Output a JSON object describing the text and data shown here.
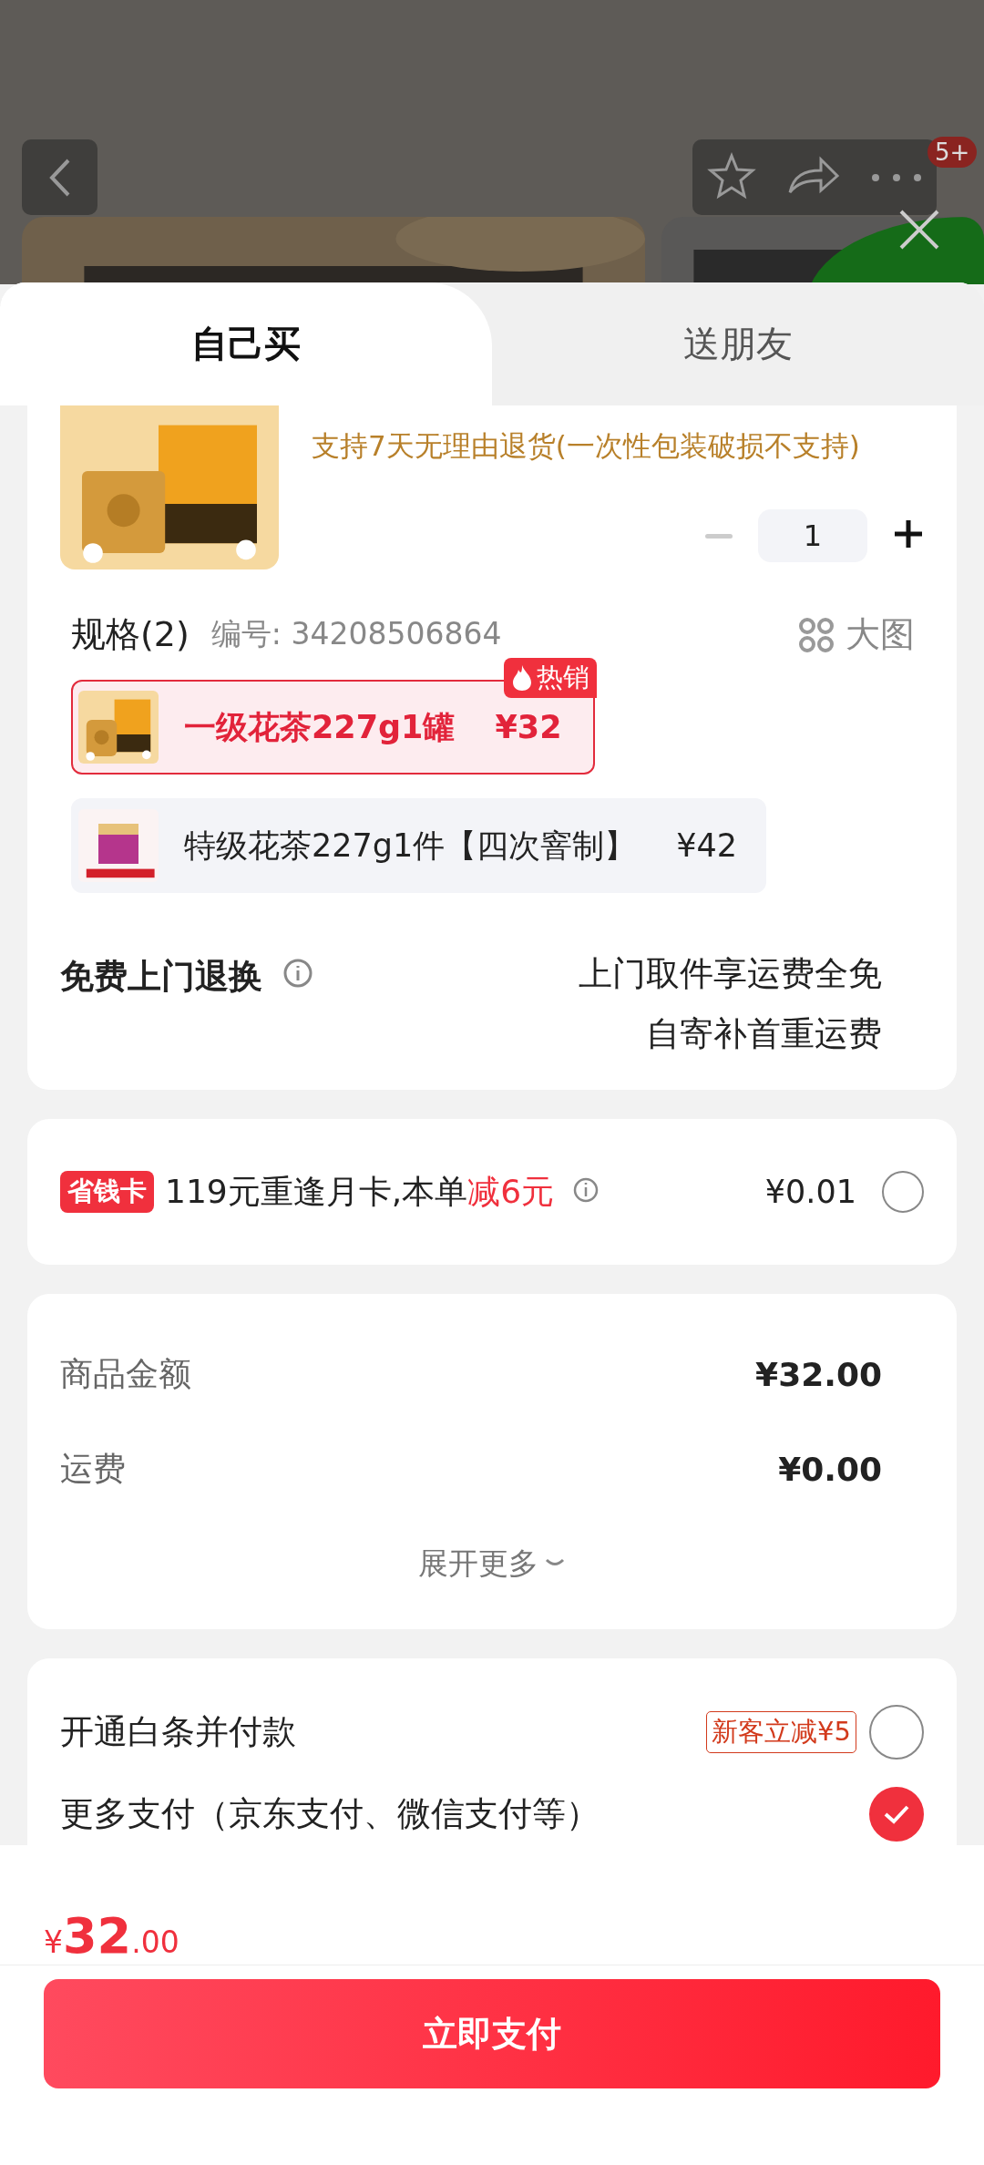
{
  "top_bar": {
    "badge": "5+"
  },
  "tabs": [
    {
      "label": "自己买",
      "selected": true
    },
    {
      "label": "送朋友",
      "selected": false
    }
  ],
  "product": {
    "return_policy": "支持7天无理由退货(一次性包装破损不支持)",
    "quantity": "1",
    "decrement_disabled": true
  },
  "specs": {
    "title": "规格(2)",
    "code": "编号: 34208506864",
    "big_image": "大图",
    "options": [
      {
        "name": "一级花茶227g1罐",
        "price": "¥32",
        "tag": "热销",
        "selected": true
      },
      {
        "name": "特级花茶227g1件【四次窨制】",
        "price": "¥42",
        "selected": false
      }
    ]
  },
  "return_service": {
    "title": "免费上门退换",
    "lines": [
      "上门取件享运费全免",
      "自寄补首重运费"
    ]
  },
  "savings_card": {
    "badge": "省钱卡",
    "text": "119元重逢月卡,本单",
    "highlight": "减6元",
    "price": "¥0.01",
    "checked": false
  },
  "summary": {
    "rows": [
      {
        "label": "商品金额",
        "value": "¥32.00"
      },
      {
        "label": "运费",
        "value": "¥0.00"
      }
    ],
    "expand": "展开更多"
  },
  "payment": [
    {
      "label": "开通白条并付款",
      "promo": "新客立减¥5",
      "selected": false
    },
    {
      "label": "更多支付（京东支付、微信支付等）",
      "selected": true
    }
  ],
  "footer": {
    "currency": "¥",
    "price_int": "32",
    "price_dec": ".00",
    "button": "立即支付"
  }
}
